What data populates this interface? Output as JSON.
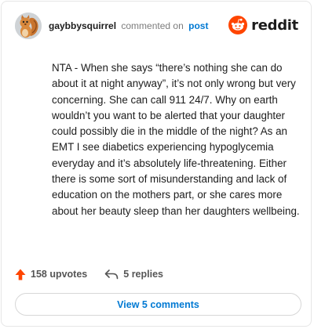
{
  "header": {
    "username": "gaybbysquirrel",
    "commented_on": "commented on",
    "post_link": "post",
    "brand": "reddit",
    "avatar_icon": "squirrel-avatar-icon",
    "brand_icon": "reddit-logo-icon"
  },
  "comment": {
    "text": "NTA - When she says “there’s nothing she can do about it at night anyway”, it’s not only wrong but very concerning. She can call 911 24/7. Why on earth wouldn’t you want to be alerted that your daughter could possibly die in the middle of the night? As an EMT I see diabetics experiencing hypoglycemia everyday and it’s absolutely life-threatening. Either there is some sort of misunderstanding and lack of education on the mothers part, or she cares more about her beauty sleep than her daughters wellbeing."
  },
  "actions": {
    "upvotes": "158 upvotes",
    "replies": "5 replies",
    "upvote_icon": "upvote-arrow-icon",
    "reply_icon": "reply-arrow-icon"
  },
  "view_comments": {
    "label": "View 5 comments"
  },
  "colors": {
    "reddit_orange": "#ff4500",
    "link_blue": "#0079d3",
    "muted_text": "#7c7c7c"
  }
}
